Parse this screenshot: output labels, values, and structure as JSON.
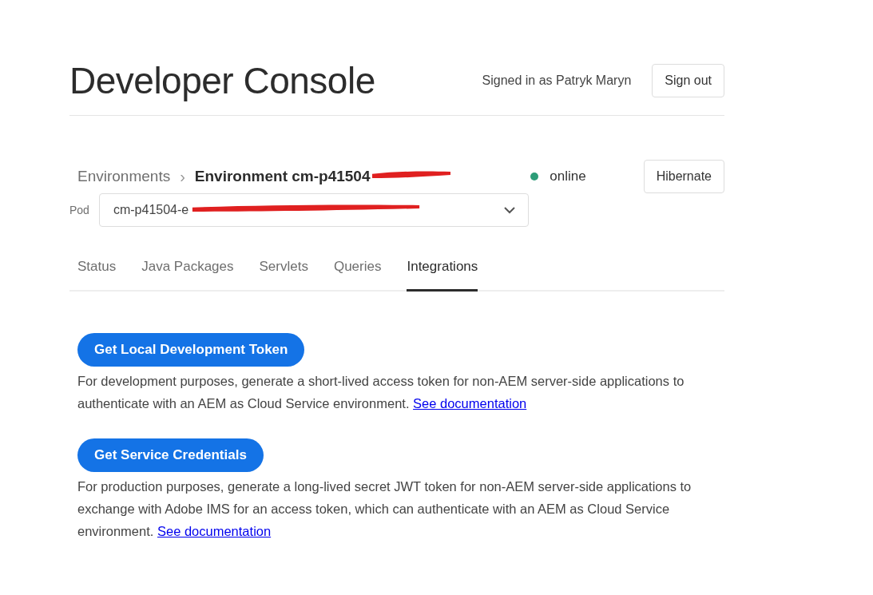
{
  "header": {
    "title": "Developer Console",
    "signed_in": "Signed in as Patryk Maryn",
    "sign_out": "Sign out"
  },
  "environment": {
    "breadcrumb_parent": "Environments",
    "breadcrumb_separator": "›",
    "name": "Environment cm-p41504",
    "redacted": true,
    "status": "online",
    "hibernate": "Hibernate"
  },
  "pod": {
    "label": "Pod",
    "value": "cm-p41504-e",
    "redacted": true
  },
  "tabs": [
    {
      "label": "Status",
      "selected": false
    },
    {
      "label": "Java Packages",
      "selected": false
    },
    {
      "label": "Servlets",
      "selected": false
    },
    {
      "label": "Queries",
      "selected": false
    },
    {
      "label": "Integrations",
      "selected": true
    }
  ],
  "integrations": [
    {
      "button": "Get Local Development Token",
      "description": "For development purposes, generate a short-lived access token for non-AEM server-side applications to authenticate with an AEM as Cloud Service environment.",
      "link": "See documentation"
    },
    {
      "button": "Get Service Credentials",
      "description": "For production purposes, generate a long-lived secret JWT token for non-AEM server-side applications to exchange with Adobe IMS for an access token, which can authenticate with an AEM as Cloud Service environment.",
      "link": "See documentation"
    }
  ]
}
